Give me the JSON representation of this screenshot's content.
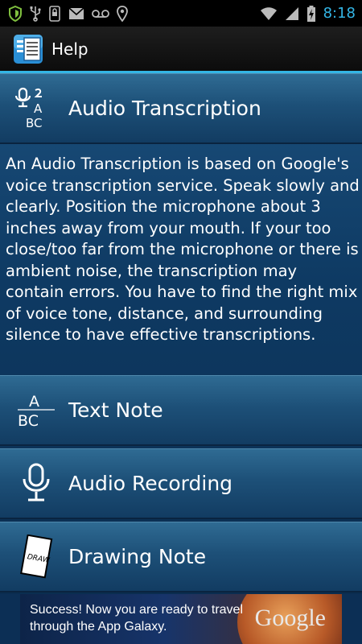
{
  "status_bar": {
    "time": "8:18",
    "left_icons": [
      "shield-icon",
      "usb-icon",
      "phone-lock-icon",
      "mail-icon",
      "voicemail-icon",
      "location-pin-icon"
    ],
    "right_icons": [
      "wifi-icon",
      "signal-icon",
      "battery-charging-icon"
    ],
    "accent": "#33b5e5"
  },
  "action_bar": {
    "title": "Help",
    "icon": "notes-app-icon"
  },
  "sections": {
    "audio_transcription": {
      "label": "Audio Transcription",
      "icon": "mic-to-abc-icon",
      "description": "An Audio Transcription is based on Google's voice transcription service. Speak slowly and clearly. Position the microphone about 3 inches away from your mouth. If your too close/too far from the microphone or there is ambient noise, the transcription may contain errors. You have to find the right mix of voice tone, distance, and surrounding silence to have effective transcriptions."
    },
    "text_note": {
      "label": "Text Note",
      "icon": "abc-icon"
    },
    "audio_recording": {
      "label": "Audio Recording",
      "icon": "microphone-icon"
    },
    "drawing_note": {
      "label": "Drawing Note",
      "icon": "draw-card-icon",
      "icon_text": "DRAW"
    }
  },
  "ad": {
    "text": "Success! Now you are ready to travel through the App Galaxy.",
    "logo": "Google"
  }
}
